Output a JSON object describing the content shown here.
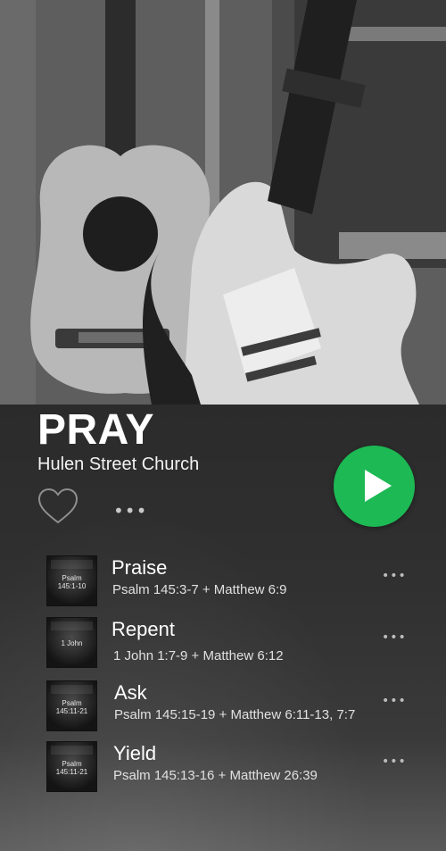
{
  "header": {
    "title": "PRAY",
    "artist": "Hulen Street Church"
  },
  "controls": {
    "play_icon": "play-icon",
    "like_icon": "heart-outline-icon",
    "more_glyph": "•••",
    "accent_color": "#1db954"
  },
  "tracks": [
    {
      "title": "Praise",
      "reference": "Psalm 145:3-7 + Matthew 6:9",
      "thumb_text": "Psalm\n145:1-10",
      "more_glyph": "•••"
    },
    {
      "title": "Repent",
      "reference": "1 John 1:7-9 + Matthew 6:12",
      "thumb_text": "1 John",
      "more_glyph": "•••"
    },
    {
      "title": "Ask",
      "reference": "Psalm 145:15-19 + Matthew 6:11-13, 7:7",
      "thumb_text": "Psalm\n145:11-21",
      "more_glyph": "•••"
    },
    {
      "title": "Yield",
      "reference": "Psalm 145:13-16 + Matthew 26:39",
      "thumb_text": "Psalm\n145:11-21",
      "more_glyph": "•••"
    }
  ]
}
